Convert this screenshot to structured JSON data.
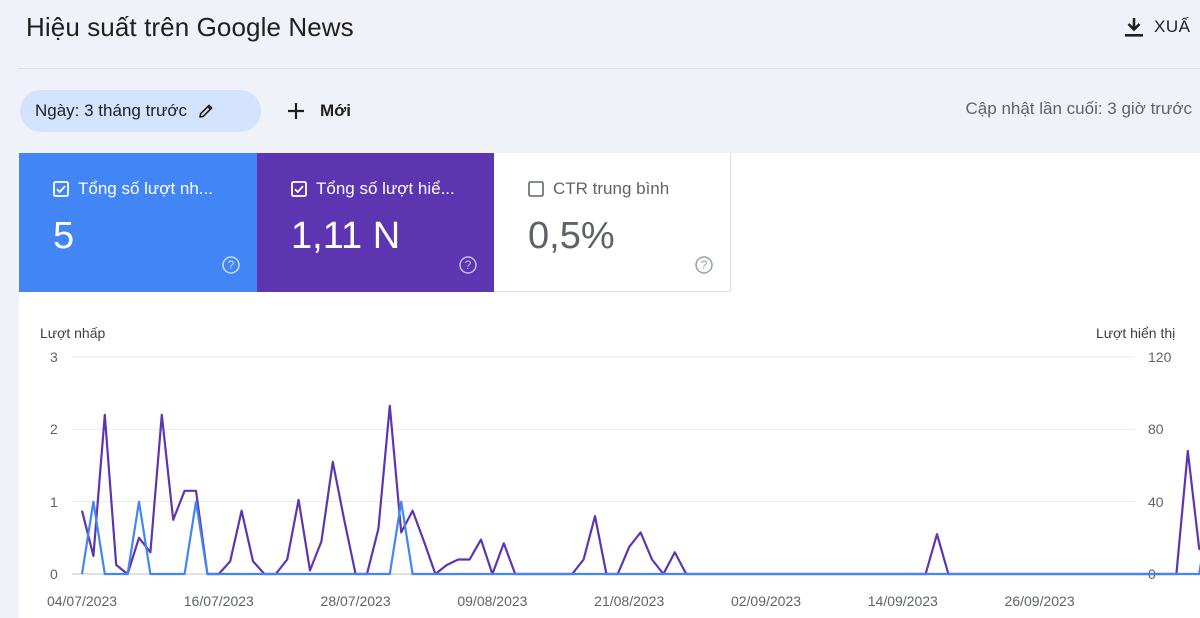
{
  "header": {
    "title": "Hiệu suất trên Google News",
    "export_label": "XUẤ"
  },
  "toolbar": {
    "date_filter": "Ngày: 3 tháng trước",
    "new_label": "Mới",
    "last_updated": "Cập nhật lần cuối: 3 giờ trước"
  },
  "metrics": [
    {
      "label": "Tổng số lượt nh...",
      "value": "5",
      "checked": true,
      "color": "#4285f4"
    },
    {
      "label": "Tổng số lượt hiể...",
      "value": "1,11 N",
      "checked": true,
      "color": "#5e35b1"
    },
    {
      "label": "CTR trung bình",
      "value": "0,5%",
      "checked": false,
      "color": "#ffffff"
    }
  ],
  "chart_data": {
    "type": "line",
    "left_axis_label": "Lượt nhấp",
    "right_axis_label": "Lượt hiển thị",
    "left_ylim": [
      0,
      3
    ],
    "right_ylim": [
      0,
      120
    ],
    "left_ticks": [
      "0",
      "1",
      "2",
      "3"
    ],
    "right_ticks": [
      "0",
      "40",
      "80",
      "120"
    ],
    "x_tick_labels": [
      "04/07/2023",
      "16/07/2023",
      "28/07/2023",
      "09/08/2023",
      "21/08/2023",
      "02/09/2023",
      "14/09/2023",
      "26/09/2023"
    ],
    "x_start": "04/07/2023",
    "grid": true,
    "series": [
      {
        "name": "Tổng số lượt nhấp",
        "axis": "left",
        "color": "#4285f4",
        "values": [
          0,
          1,
          0,
          0,
          0,
          1,
          0,
          0,
          0,
          0,
          1,
          0,
          0,
          0,
          0,
          0,
          0,
          0,
          0,
          0,
          0,
          0,
          0,
          0,
          0,
          0,
          0,
          0,
          1,
          0,
          0,
          0,
          0,
          0,
          0,
          0,
          0,
          0,
          0,
          0,
          0,
          0,
          0,
          0,
          0,
          0,
          0,
          0,
          0,
          0,
          0,
          0,
          0,
          0,
          0,
          0,
          0,
          0,
          0,
          0,
          0,
          0,
          0,
          0,
          0,
          0,
          0,
          0,
          0,
          0,
          0,
          0,
          0,
          0,
          0,
          0,
          0,
          0,
          0,
          0,
          0,
          0,
          0,
          0,
          0,
          0,
          0,
          0,
          0,
          0,
          0,
          0,
          0,
          0,
          0,
          0,
          0,
          0,
          0,
          1,
          0,
          0,
          0,
          0
        ]
      },
      {
        "name": "Tổng số lượt hiển thị",
        "axis": "right",
        "color": "#5e35b1",
        "values": [
          35,
          10,
          88,
          5,
          0,
          20,
          12,
          88,
          30,
          46,
          46,
          0,
          0,
          7,
          35,
          7,
          0,
          0,
          8,
          41,
          2,
          18,
          62,
          30,
          0,
          0,
          25,
          93,
          23,
          35,
          18,
          0,
          5,
          8,
          8,
          19,
          0,
          17,
          0,
          0,
          0,
          0,
          0,
          0,
          8,
          32,
          0,
          0,
          15,
          23,
          8,
          0,
          12,
          0,
          0,
          0,
          0,
          0,
          0,
          0,
          0,
          0,
          0,
          0,
          0,
          0,
          0,
          0,
          0,
          0,
          0,
          0,
          0,
          0,
          0,
          22,
          0,
          0,
          0,
          0,
          0,
          0,
          0,
          0,
          0,
          0,
          0,
          0,
          0,
          0,
          0,
          0,
          0,
          0,
          0,
          0,
          0,
          68,
          14,
          10,
          47,
          0,
          0,
          0,
          0
        ]
      }
    ]
  }
}
